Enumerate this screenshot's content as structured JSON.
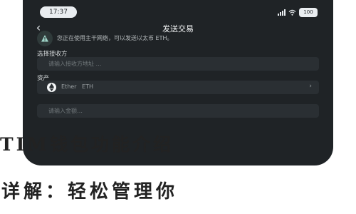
{
  "status_bar": {
    "time": "17:37",
    "battery": "100"
  },
  "nav": {
    "title": "发送交易"
  },
  "notice": {
    "text": "您正在使用主干网络，可以发送以太币 ETH。"
  },
  "recipient": {
    "label": "选择接收方",
    "placeholder": "请输入接收方地址 …"
  },
  "asset": {
    "label": "资产",
    "name": "Ether",
    "symbol": "ETH"
  },
  "amount": {
    "placeholder": "请输入金额…"
  },
  "headline": {
    "line1": "TIM钱包功能介绍",
    "line2": "详解：轻松管理你"
  },
  "colors": {
    "background": "#1f2326",
    "field": "#2a2f33",
    "accent": "#e9edf0"
  }
}
